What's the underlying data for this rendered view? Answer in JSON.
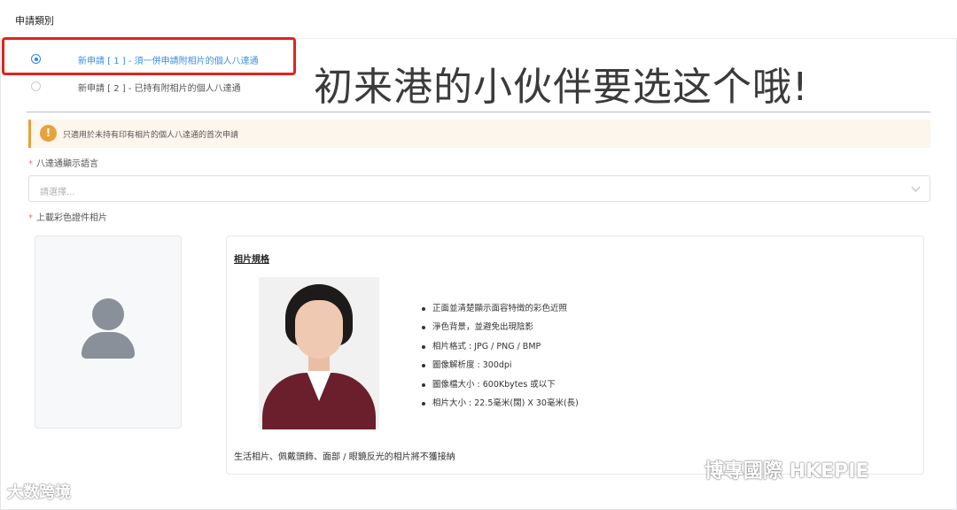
{
  "section": {
    "title": "申請類別"
  },
  "radios": [
    {
      "label": "新申請 [ 1 ] - 須一併申請附相片的個人八達通",
      "checked": true
    },
    {
      "label": "新申請 [ 2 ] - 已持有附相片的個人八達通",
      "checked": false
    }
  ],
  "overlay": {
    "text": "初来港的小伙伴要选这个哦!"
  },
  "alert": {
    "icon": "!",
    "text": "只適用於未持有印有相片的個人八達通的首次申請"
  },
  "language_field": {
    "required_mark": "*",
    "label": "八達通顯示語言",
    "placeholder": "請選擇..."
  },
  "photo_field": {
    "required_mark": "*",
    "label": "上載彩色證件相片"
  },
  "spec": {
    "title": "相片規格",
    "items": [
      "正面並清楚顯示面容特徵的彩色近照",
      "淨色背景，並避免出現陰影",
      "相片格式 : JPG / PNG / BMP",
      "圖像解析度 : 300dpi",
      "圖像檔大小 : 600Kbytes 或以下",
      "相片大小 : 22.5毫米(闊) X 30毫米(長)"
    ],
    "note": "生活相片、佩戴頭飾、面部 / 眼鏡反光的相片將不獲接納"
  },
  "watermarks": {
    "left": "大数跨境",
    "right": "博專國際 HKEPIE"
  },
  "colors": {
    "accent": "#3a8ee6",
    "highlight": "#e3221d",
    "warning": "#e6a23c",
    "required": "#f56c6c"
  }
}
